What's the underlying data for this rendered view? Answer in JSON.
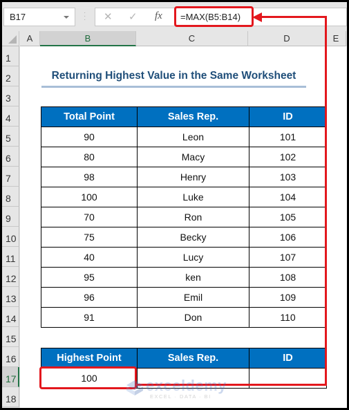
{
  "formula_bar": {
    "name_box": "B17",
    "cancel_icon": "✕",
    "enter_icon": "✓",
    "fx_label": "fx",
    "formula": "=MAX(B5:B14)"
  },
  "columns": [
    "A",
    "B",
    "C",
    "D",
    "E"
  ],
  "selected_column": "B",
  "rows": [
    "1",
    "2",
    "3",
    "4",
    "5",
    "6",
    "7",
    "8",
    "9",
    "10",
    "11",
    "12",
    "13",
    "14",
    "15",
    "16",
    "17",
    "18"
  ],
  "selected_row": "17",
  "sheet": {
    "title": "Returning Highest Value in the Same Worksheet",
    "main_table": {
      "headers": [
        "Total Point",
        "Sales Rep.",
        "ID"
      ],
      "rows": [
        [
          "90",
          "Leon",
          "101"
        ],
        [
          "80",
          "Macy",
          "102"
        ],
        [
          "98",
          "Henry",
          "103"
        ],
        [
          "100",
          "Luke",
          "104"
        ],
        [
          "70",
          "Ron",
          "105"
        ],
        [
          "75",
          "Becky",
          "106"
        ],
        [
          "40",
          "Lucy",
          "107"
        ],
        [
          "95",
          "ken",
          "108"
        ],
        [
          "96",
          "Emil",
          "109"
        ],
        [
          "91",
          "Don",
          "110"
        ]
      ]
    },
    "result_table": {
      "headers": [
        "Highest Point",
        "Sales Rep.",
        "ID"
      ],
      "row": [
        "100",
        "",
        ""
      ]
    }
  },
  "watermark": {
    "brand": "exceldemy",
    "tagline": "EXCEL · DATA · BI"
  },
  "colors": {
    "header_fill": "#0070c0",
    "title_text": "#1f4e79",
    "annotation": "#e3171d",
    "selection_green": "#217346"
  }
}
